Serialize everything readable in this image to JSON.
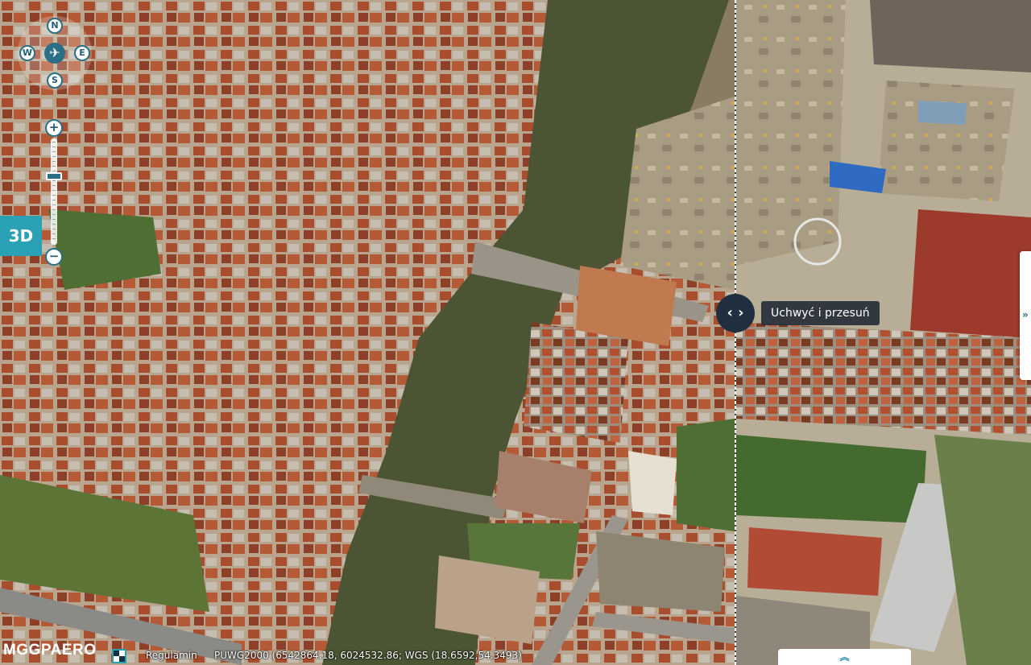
{
  "map": {
    "left_panel": "aerial-oblique-photo",
    "right_panel": "orthophoto",
    "colors": {
      "water": "#4b5533",
      "roofs_red": "#a8502f",
      "greenery": "#4e6e33",
      "accent": "#2aa1b4"
    }
  },
  "compass": {
    "north": "N",
    "south": "S",
    "west": "W",
    "east": "E",
    "center_icon": "airplane-icon"
  },
  "zoom": {
    "plus": "+",
    "minus": "−"
  },
  "view_toggle": {
    "label": "3D"
  },
  "swipe": {
    "handle_icon": "‹ ›",
    "tooltip": "Uchwyć i przesuń"
  },
  "right_tab": {
    "icon": "»"
  },
  "bottom_tab": {
    "icon": "︽"
  },
  "footer": {
    "logo_mggp": "MGGP",
    "logo_aero": "AERO",
    "terms_link": "Regulamin",
    "coordinates": "PUWG2000 (6542864.18, 6024532.86; WGS (18.6592,54.3493)"
  }
}
